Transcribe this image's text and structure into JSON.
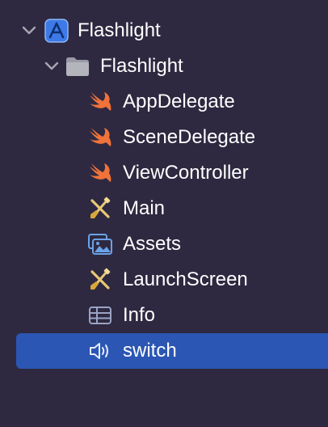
{
  "project": {
    "name": "Flashlight",
    "expanded": true,
    "icon": "xcode-project-icon",
    "group": {
      "name": "Flashlight",
      "expanded": true,
      "icon": "folder-icon",
      "files": [
        {
          "name": "AppDelegate",
          "icon": "swift-file-icon",
          "selected": false
        },
        {
          "name": "SceneDelegate",
          "icon": "swift-file-icon",
          "selected": false
        },
        {
          "name": "ViewController",
          "icon": "swift-file-icon",
          "selected": false
        },
        {
          "name": "Main",
          "icon": "storyboard-icon",
          "selected": false
        },
        {
          "name": "Assets",
          "icon": "asset-catalog-icon",
          "selected": false
        },
        {
          "name": "LaunchScreen",
          "icon": "storyboard-icon",
          "selected": false
        },
        {
          "name": "Info",
          "icon": "plist-icon",
          "selected": false
        },
        {
          "name": "switch",
          "icon": "audio-file-icon",
          "selected": true
        }
      ]
    }
  },
  "colors": {
    "background": "#2e2940",
    "selection": "#2b56b3",
    "swift": "#f0733a",
    "folder": "#9a9aa6",
    "project": "#3d7ae8"
  }
}
